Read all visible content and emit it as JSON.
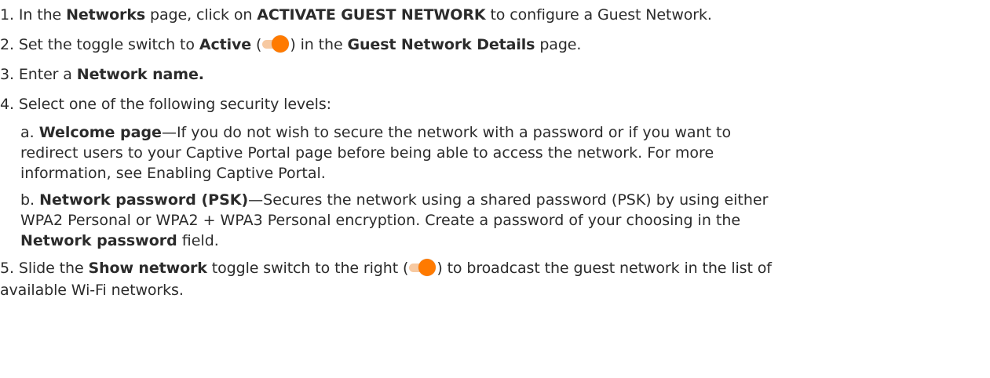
{
  "steps": {
    "s1": {
      "num": "1. In the ",
      "b1": "Networks",
      "t1": " page, click on ",
      "b2": "ACTIVATE GUEST NETWORK",
      "t2": " to configure a Guest Network."
    },
    "s2": {
      "num": "2. Set the toggle switch to ",
      "b1": "Active",
      "t1": " (",
      "t2": ") in the ",
      "b2": "Guest Network Details",
      "t3": " page."
    },
    "s3": {
      "num": "3. Enter a ",
      "b1": "Network name."
    },
    "s4": {
      "text": "4. Select one of the following security levels:"
    },
    "s4a": {
      "prefix": "a. ",
      "b1": "Welcome page",
      "t1": "—If you do not wish to secure the network with a password or if you want to",
      "line2": "redirect users to your Captive Portal page before being able to access the network. For more",
      "line3": "information, see Enabling Captive Portal."
    },
    "s4b": {
      "prefix": "b. ",
      "b1": "Network password (PSK)",
      "t1": "—Secures the network using a shared password (PSK) by using either",
      "line2": "WPA2 Personal or WPA2 + WPA3 Personal encryption. Create a password of your choosing in the",
      "b2": "Network password",
      "t2": " field."
    },
    "s5": {
      "num": "5. Slide the ",
      "b1": "Show network",
      "t1": " toggle switch to the right (",
      "t2": ") to broadcast the guest network in the list of",
      "line2": "available Wi-Fi networks."
    }
  },
  "colors": {
    "toggle_knob": "#ff7a00",
    "toggle_track": "#f7c9a1",
    "text": "#2b2b2b"
  },
  "icons": {
    "toggle": "toggle-on-icon"
  }
}
